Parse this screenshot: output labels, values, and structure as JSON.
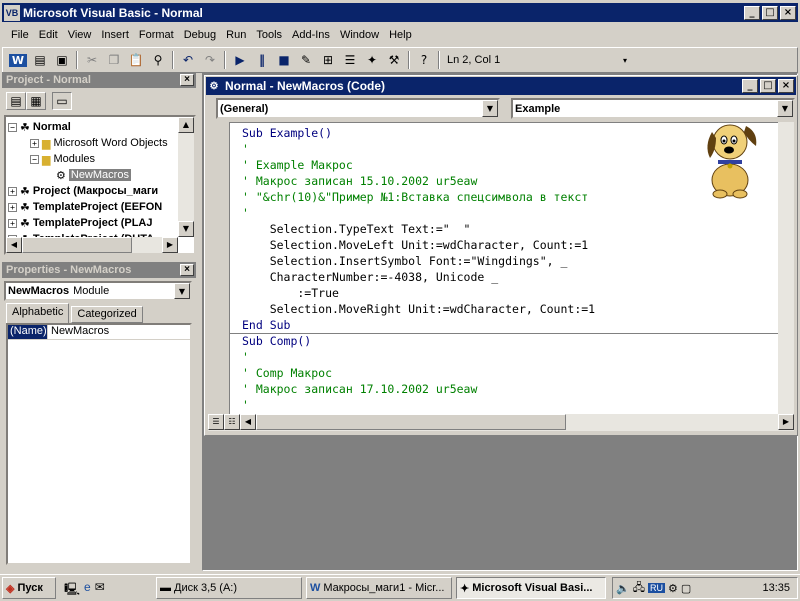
{
  "app": {
    "title": "Microsoft Visual Basic - Normal"
  },
  "menu": [
    {
      "label": "File"
    },
    {
      "label": "Edit"
    },
    {
      "label": "View"
    },
    {
      "label": "Insert"
    },
    {
      "label": "Format"
    },
    {
      "label": "Debug"
    },
    {
      "label": "Run"
    },
    {
      "label": "Tools"
    },
    {
      "label": "Add-Ins"
    },
    {
      "label": "Window"
    },
    {
      "label": "Help"
    }
  ],
  "toolbar": {
    "position": "Ln 2, Col 1"
  },
  "project": {
    "title": "Project - Normal",
    "tree": [
      {
        "label": "Normal",
        "bold": true
      },
      {
        "label": "Microsoft Word Objects"
      },
      {
        "label": "Modules"
      },
      {
        "label": "NewMacros"
      },
      {
        "label": "Project (Макросы_маги",
        "bold": true
      },
      {
        "label": "TemplateProject (EEFON",
        "bold": true
      },
      {
        "label": "TemplateProject (PLAJ",
        "bold": true
      },
      {
        "label": "TemplateProject (DUTA",
        "bold": true
      }
    ]
  },
  "properties": {
    "title": "Properties - NewMacros",
    "object_name": "NewMacros",
    "object_type": "Module",
    "tabs": [
      {
        "label": "Alphabetic"
      },
      {
        "label": "Categorized"
      }
    ],
    "rows": [
      {
        "name": "(Name)",
        "value": "NewMacros"
      }
    ]
  },
  "code_window": {
    "title": "Normal - NewMacros (Code)",
    "object_combo": "(General)",
    "proc_combo": "Example",
    "lines": [
      {
        "text": "Sub Example()",
        "type": "kw"
      },
      {
        "text": "'",
        "type": "cm"
      },
      {
        "text": "' Example Макрос",
        "type": "cm"
      },
      {
        "text": "' Макрос записан 15.10.2002 ur5eaw",
        "type": "cm"
      },
      {
        "text": "' \"&chr(10)&\"Пример №1:Вставка спецсимвола в текст",
        "type": "cm"
      },
      {
        "text": "'",
        "type": "cm"
      },
      {
        "text": "    Selection.TypeText Text:=\"  \"",
        "type": "normal"
      },
      {
        "text": "    Selection.MoveLeft Unit:=wdCharacter, Count:=1",
        "type": "normal"
      },
      {
        "text": "    Selection.InsertSymbol Font:=\"Wingdings\", _",
        "type": "normal"
      },
      {
        "text": "    CharacterNumber:=-4038, Unicode _",
        "type": "normal"
      },
      {
        "text": "        :=True",
        "type": "normal"
      },
      {
        "text": "    Selection.MoveRight Unit:=wdCharacter, Count:=1",
        "type": "normal"
      },
      {
        "text": "End Sub",
        "type": "kw"
      },
      {
        "text": "Sub Comp()",
        "type": "kw"
      },
      {
        "text": "'",
        "type": "cm"
      },
      {
        "text": "' Comp Макрос",
        "type": "cm"
      },
      {
        "text": "' Макрос записан 17.10.2002 ur5eaw",
        "type": "cm"
      },
      {
        "text": "'",
        "type": "cm"
      }
    ]
  },
  "taskbar": {
    "start": "Пуск",
    "tasks": [
      {
        "label": "Диск 3,5 (A:)"
      },
      {
        "label": "Макросы_маги1 - Micr..."
      },
      {
        "label": "Microsoft Visual Basi..."
      }
    ],
    "lang": "RU",
    "clock": "13:35"
  }
}
